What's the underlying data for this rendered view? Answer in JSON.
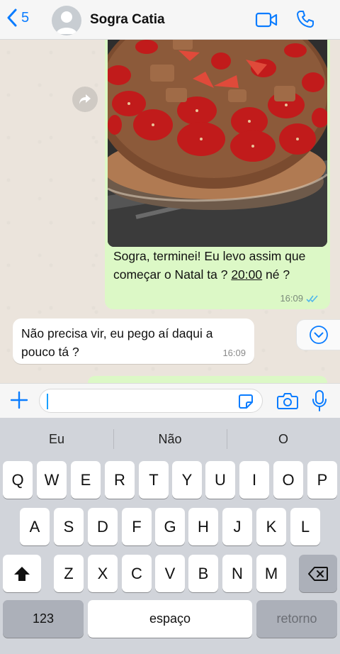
{
  "header": {
    "back_count": "5",
    "contact_name": "Sogra Catia"
  },
  "messages": {
    "outgoing": {
      "text_before": "Sogra, terminei! Eu levo assim que começar o Natal ta ? ",
      "time_link": "20:00",
      "text_after": " né ?",
      "timestamp": "16:09",
      "status": "read"
    },
    "incoming": {
      "text": "Não precisa vir, eu pego aí daqui a pouco tá ?",
      "timestamp": "16:09"
    }
  },
  "input": {
    "value": "",
    "placeholder": ""
  },
  "keyboard": {
    "suggestions": [
      "Eu",
      "Não",
      "O"
    ],
    "row1": [
      "Q",
      "W",
      "E",
      "R",
      "T",
      "Y",
      "U",
      "I",
      "O",
      "P"
    ],
    "row2": [
      "A",
      "S",
      "D",
      "F",
      "G",
      "H",
      "J",
      "K",
      "L"
    ],
    "row3": [
      "Z",
      "X",
      "C",
      "V",
      "B",
      "N",
      "M"
    ],
    "numbers_key": "123",
    "space_key": "espaço",
    "return_key": "retorno"
  },
  "colors": {
    "accent": "#0a7cff",
    "outgoing_bubble": "#dcf8c6",
    "incoming_bubble": "#ffffff",
    "read_ticks": "#4fb6ec"
  }
}
